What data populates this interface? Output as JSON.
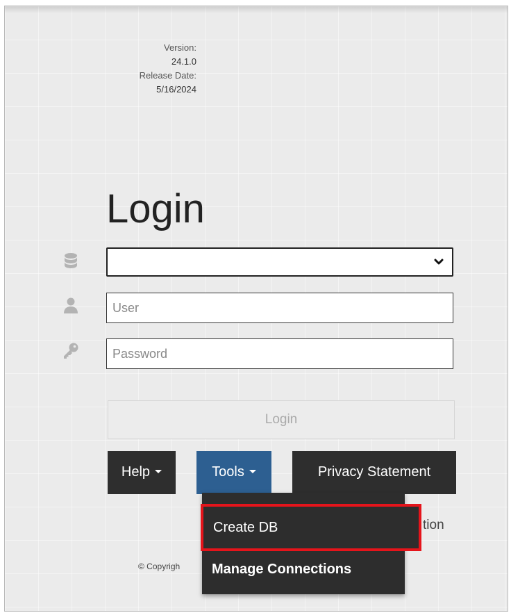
{
  "version": {
    "version_label": "Version:",
    "version_value": "24.1.0",
    "release_label": "Release Date:",
    "release_value": "5/16/2024"
  },
  "login": {
    "title": "Login",
    "user_placeholder": "User",
    "password_placeholder": "Password",
    "login_button": "Login"
  },
  "buttons": {
    "help": "Help",
    "tools": "Tools",
    "privacy": "Privacy Statement"
  },
  "background_texts": {
    "connection_fragment": "tion",
    "copyright_fragment": "© Copyrigh"
  },
  "tools_menu": {
    "items": [
      "Create DB",
      "Manage Connections"
    ],
    "highlighted": "Create DB"
  },
  "icons": {
    "database": "database-icon",
    "user": "user-icon",
    "password": "key-icon",
    "select_chevron": "chevron-down-icon",
    "dropdown_caret": "caret-down-icon"
  },
  "colors": {
    "tools_button": "#2d5f91",
    "dark_button": "#2e2e2e",
    "highlight_border": "#e5141b"
  }
}
